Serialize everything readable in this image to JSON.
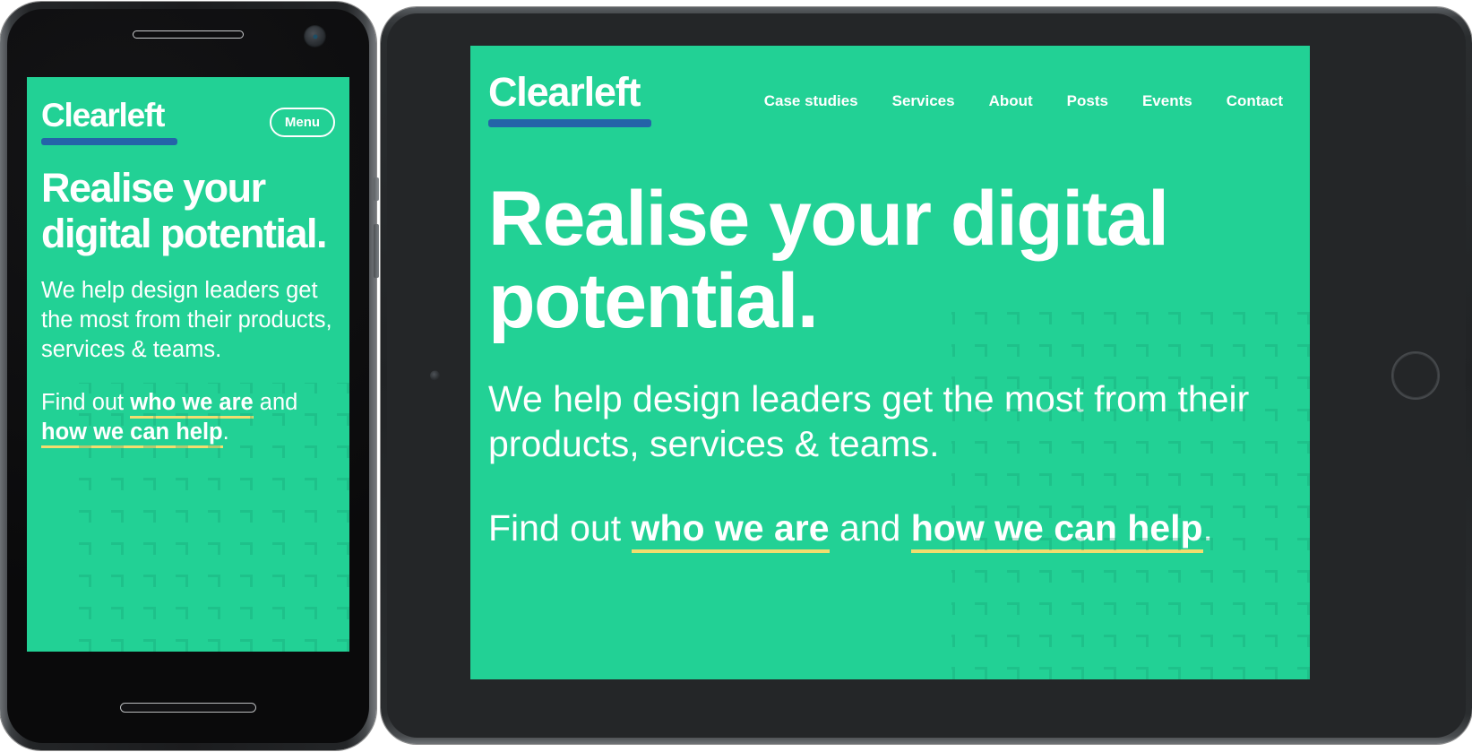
{
  "brand": {
    "name": "Clearleft",
    "accent_green": "#22d195",
    "logo_underline_blue": "#2464a8",
    "link_underline_yellow": "#f2dd6e",
    "text_white": "#ffffff"
  },
  "phone": {
    "device": "smartphone-mockup",
    "menu_button_label": "Menu",
    "headline": "Realise your digital potential.",
    "lede": "We help design leaders get the most from their products, services & teams.",
    "find_prefix": "Find out ",
    "link_one": "who we are",
    "find_middle": " and ",
    "link_two": "how we can help",
    "find_suffix": "."
  },
  "tablet": {
    "device": "tablet-mockup",
    "nav": [
      {
        "label": "Case studies"
      },
      {
        "label": "Services"
      },
      {
        "label": "About"
      },
      {
        "label": "Posts"
      },
      {
        "label": "Events"
      },
      {
        "label": "Contact"
      }
    ],
    "headline": "Realise your digital potential.",
    "lede": "We help design leaders get the most from their products, services & teams.",
    "find_prefix": "Find out ",
    "link_one": "who we are",
    "find_middle": " and ",
    "link_two": "how we can help",
    "find_suffix": "."
  }
}
